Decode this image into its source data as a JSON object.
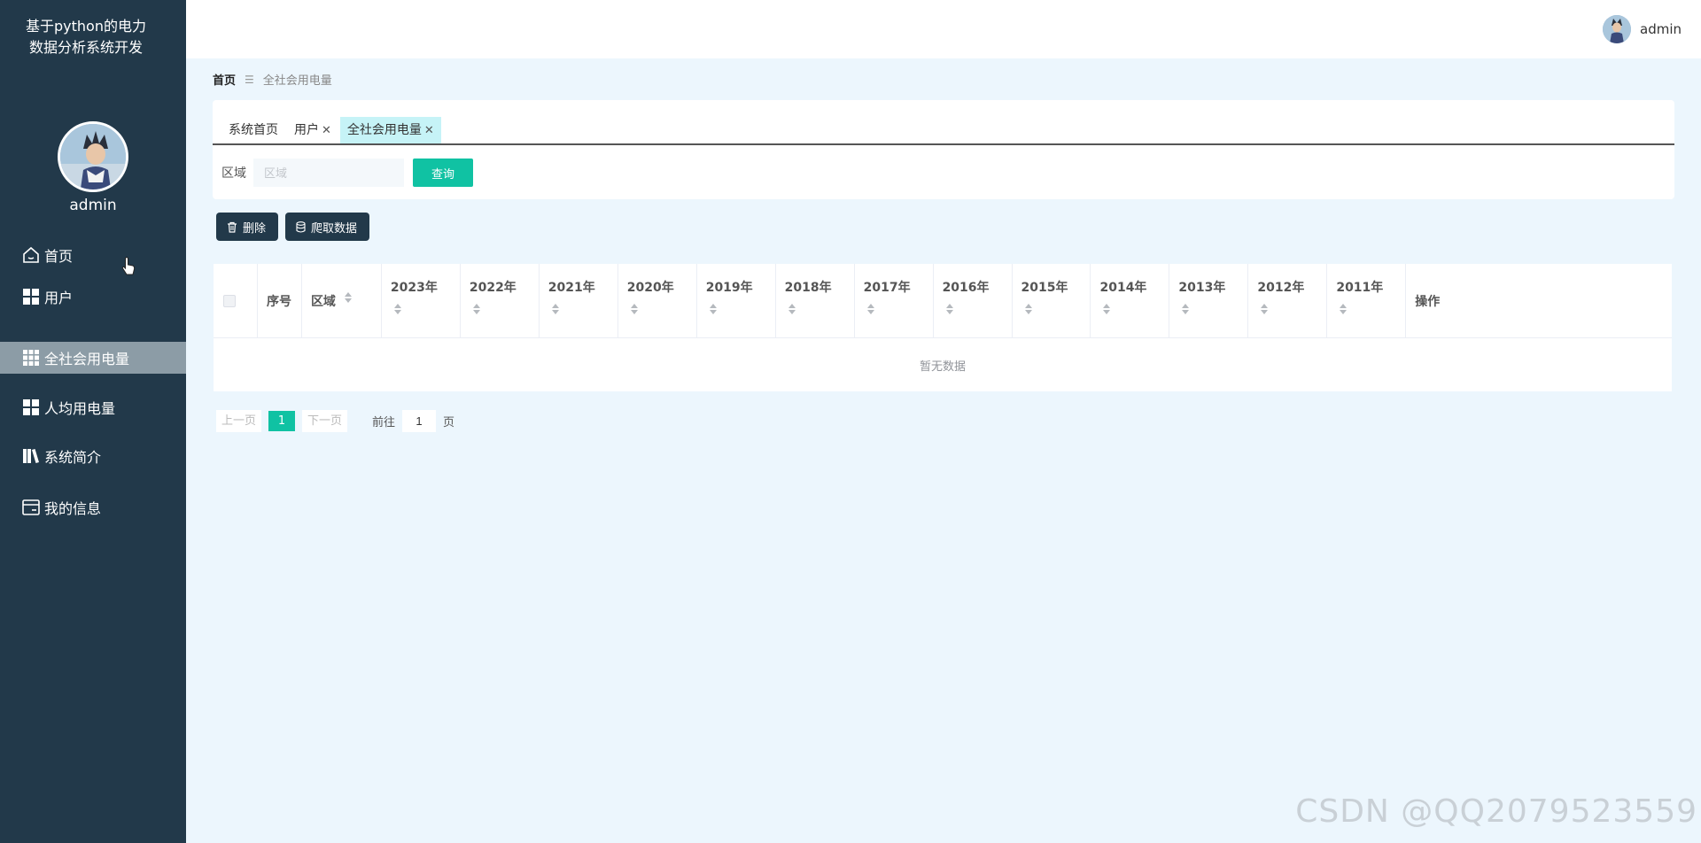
{
  "app": {
    "title_line1": "基于python的电力",
    "title_line2": "数据分析系统开发"
  },
  "sidebar": {
    "username": "admin",
    "items": [
      {
        "label": "首页",
        "icon": "home-icon"
      },
      {
        "label": "用户",
        "icon": "grid-icon"
      },
      {
        "label": "全社会用电量",
        "icon": "grid9-icon",
        "active": true
      },
      {
        "label": "人均用电量",
        "icon": "grid-icon"
      },
      {
        "label": "系统简介",
        "icon": "book-icon"
      },
      {
        "label": "我的信息",
        "icon": "card-icon"
      }
    ]
  },
  "header": {
    "username": "admin"
  },
  "breadcrumb": {
    "home": "首页",
    "separator": "☰",
    "current": "全社会用电量"
  },
  "tabs": [
    {
      "label": "系统首页",
      "closable": false
    },
    {
      "label": "用户",
      "closable": true
    },
    {
      "label": "全社会用电量",
      "closable": true,
      "active": true
    }
  ],
  "search": {
    "label": "区域",
    "placeholder": "区域",
    "button": "查询"
  },
  "actions": {
    "delete": "删除",
    "crawl": "爬取数据"
  },
  "table": {
    "columns": [
      "序号",
      "区域",
      "2023年",
      "2022年",
      "2021年",
      "2020年",
      "2019年",
      "2018年",
      "2017年",
      "2016年",
      "2015年",
      "2014年",
      "2013年",
      "2012年",
      "2011年",
      "操作"
    ],
    "empty_text": "暂无数据"
  },
  "pagination": {
    "prev": "上一页",
    "page": "1",
    "next": "下一页",
    "goto_prefix": "前往",
    "goto_value": "1",
    "goto_suffix": "页"
  },
  "watermark": "CSDN @QQ2079523559",
  "colors": {
    "sidebar": "#22394a",
    "accent": "#10c2a3",
    "active_menu": "#8c9ca6",
    "tab_active": "#c6f3f7"
  }
}
